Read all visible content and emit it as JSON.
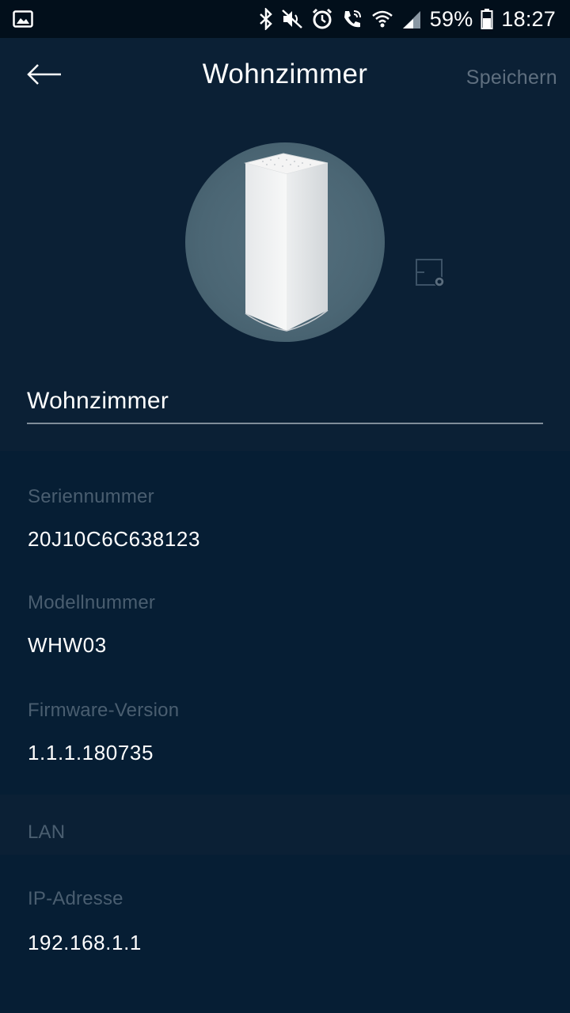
{
  "status_bar": {
    "battery_percent": "59%",
    "time": "18:27",
    "icons": [
      "image-icon",
      "bluetooth-icon",
      "mute-icon",
      "alarm-icon",
      "wifi-calling-icon",
      "wifi-icon",
      "signal-icon",
      "battery-icon"
    ]
  },
  "header": {
    "title": "Wohnzimmer",
    "save_label": "Speichern",
    "back_icon": "back-arrow-icon"
  },
  "device": {
    "name_value": "Wohnzimmer"
  },
  "details": {
    "serial_label": "Seriennummer",
    "serial_value": "20J10C6C638123",
    "model_label": "Modellnummer",
    "model_value": "WHW03",
    "firmware_label": "Firmware-Version",
    "firmware_value": "1.1.1.180735"
  },
  "lan": {
    "section_label": "LAN",
    "ip_label": "IP-Adresse",
    "ip_value": "192.168.1.1"
  },
  "colors": {
    "background": "#051e33",
    "app_bar": "#0b2035",
    "label_text": "#4a5e70",
    "disabled_action": "#5f6f7f"
  }
}
